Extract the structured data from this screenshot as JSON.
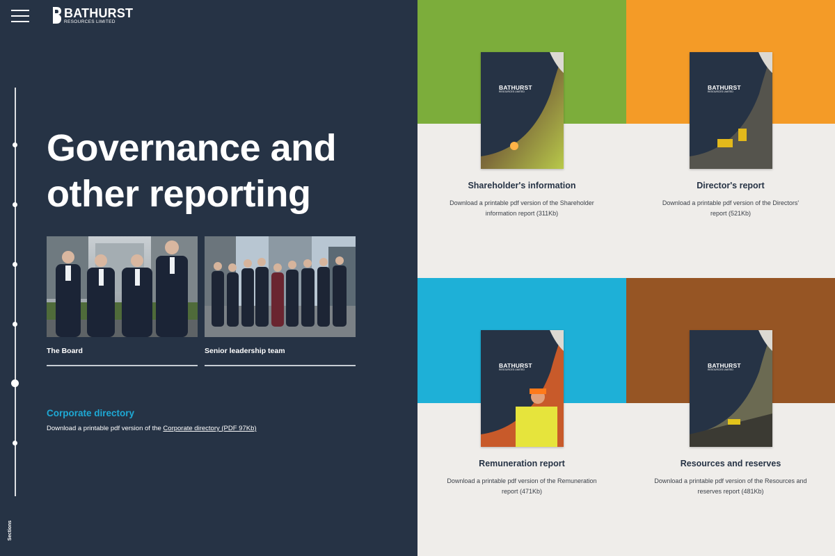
{
  "brand": {
    "name": "BATHURST",
    "subtitle": "RESOURCES LIMITED"
  },
  "nav": {
    "sections_label": "Sections"
  },
  "page": {
    "heading": "Governance and other reporting"
  },
  "people_cards": [
    {
      "caption": "The Board"
    },
    {
      "caption": "Senior leadership team"
    }
  ],
  "corporate_directory": {
    "title": "Corporate directory",
    "text": "Download a printable pdf version of the ",
    "link": "Corporate directory (PDF 97Kb)"
  },
  "reports": [
    {
      "title": "Shareholder's information",
      "description": "Download a printable pdf version of the Shareholder information report (311Kb)",
      "band_color": "#7cad3b",
      "cover_name": "BATHURST",
      "cover_sub": "RESOURCES LIMITED"
    },
    {
      "title": "Director's report",
      "description": "Download a printable pdf version of the Directors' report (521Kb)",
      "band_color": "#f49b27",
      "cover_name": "BATHURST",
      "cover_sub": "RESOURCES LIMITED"
    },
    {
      "title": "Remuneration report",
      "description": "Download a printable pdf version of the Remuneration report (471Kb)",
      "band_color": "#1eb0d7",
      "cover_name": "BATHURST",
      "cover_sub": "RESOURCES LIMITED"
    },
    {
      "title": "Resources and reserves",
      "description": "Download a printable pdf version of the Resources and reserves report (481Kb)",
      "band_color": "#965524",
      "cover_name": "BATHURST",
      "cover_sub": "RESOURCES LIMITED"
    }
  ],
  "colors": {
    "panel": "#263345",
    "accent": "#1ea9d5",
    "background": "#efedea"
  }
}
